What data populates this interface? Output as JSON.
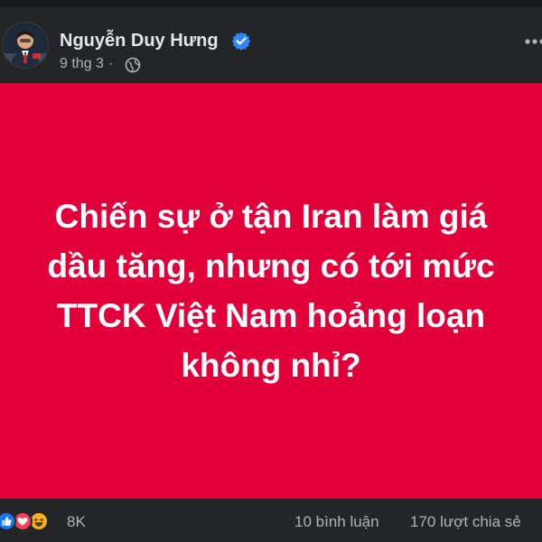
{
  "post": {
    "author": "Nguyễn Duy Hưng",
    "date": "9 thg 3",
    "separator": "·",
    "text": "Chiến sự ở tận Iran làm giá dầu tăng, nhưng có tới mức TTCK Việt Nam hoảng loạn không nhỉ?",
    "background_color": "#e2003b",
    "text_color": "#ffffff"
  },
  "stats": {
    "reactions_count": "8K",
    "comments": "10 bình luận",
    "shares": "170 lượt chia sẻ"
  },
  "icons": {
    "verified": "verified-badge-icon",
    "audience": "globe-icon",
    "more": "more-options-icon",
    "reactions": [
      "like-icon",
      "love-icon",
      "haha-icon"
    ]
  }
}
